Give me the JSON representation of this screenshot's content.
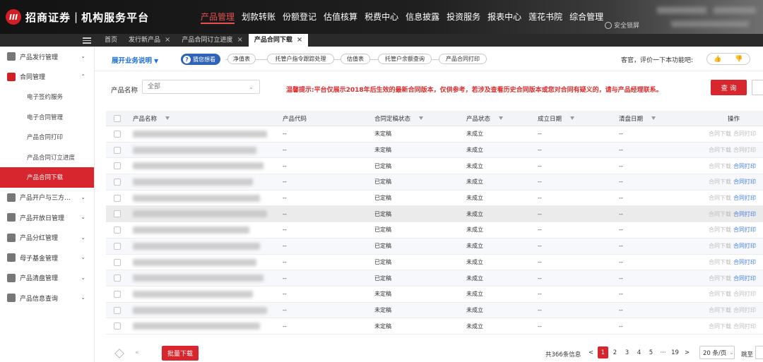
{
  "header": {
    "logo_mark": "III",
    "brand_name": "招商证券",
    "separator": "|",
    "platform_name": "机构服务平台",
    "nav": [
      "产品管理",
      "划款转账",
      "份额登记",
      "估值核算",
      "税费中心",
      "信息披露",
      "投资服务",
      "报表中心",
      "莲花书院",
      "综合管理"
    ],
    "active_nav_index": 0,
    "safe_lock_label": "安全锁屏"
  },
  "tabs": {
    "items": [
      {
        "label": "首页",
        "closable": false
      },
      {
        "label": "发行新产品",
        "closable": true
      },
      {
        "label": "产品合同订立进度",
        "closable": true
      },
      {
        "label": "产品合同下载",
        "closable": true
      }
    ],
    "active_index": 3,
    "close_glyph": "×"
  },
  "sidebar": {
    "groups": [
      {
        "label": "产品发行管理",
        "icon": "document-icon",
        "chevron": "⌄"
      },
      {
        "label": "合同管理",
        "icon": "contract-icon",
        "chevron": "⌃",
        "expanded": true,
        "children": [
          "电子签约服务",
          "电子合同管理",
          "产品合同打印",
          "产品合同订立进度",
          "产品合同下载"
        ],
        "active_child": 4
      },
      {
        "label": "产品开户与三方...",
        "icon": "link-icon",
        "chevron": "⌄"
      },
      {
        "label": "产品开放日管理",
        "icon": "calendar-icon",
        "chevron": "⌄"
      },
      {
        "label": "产品分红管理",
        "icon": "dividend-icon",
        "chevron": "⌄"
      },
      {
        "label": "母子基金管理",
        "icon": "fund-icon",
        "chevron": "⌄"
      },
      {
        "label": "产品清盘管理",
        "icon": "liquidation-icon",
        "chevron": "⌄"
      },
      {
        "label": "产品信息查询",
        "icon": "grid-icon",
        "chevron": "⌄"
      }
    ]
  },
  "func_bar": {
    "dropdown_label": "展开业务说明",
    "dropdown_caret": "▼",
    "guide_label": "猜您想看",
    "guide_glyph": "?",
    "chain": [
      "净值表",
      "托管户指令跟踪处理",
      "估值表",
      "托管户余额查询",
      "产品合同打印"
    ],
    "feedback_text": "客官，评价一下本功能吧:",
    "thumb_up": "👍",
    "thumb_down": "👎"
  },
  "filter": {
    "name_label": "产品名称",
    "name_placeholder": "全部",
    "caret": "⌄",
    "notice": "温馨提示:平台仅展示2018年后生效的最新合同版本，仅供参考，若涉及查看历史合同版本或您对合同有疑义的，请与产品经理联系。",
    "query_label": "查 询"
  },
  "table": {
    "columns": [
      "产品名称",
      "产品代码",
      "合同定稿状态",
      "产品状态",
      "成立日期",
      "清盘日期",
      "操作"
    ],
    "filterable": [
      true,
      false,
      true,
      true,
      true,
      true,
      false
    ],
    "op_download": "合同下载",
    "op_print": "合同打印",
    "rows": [
      {
        "code": "--",
        "status": "未定稿",
        "state": "未成立",
        "setup": "--",
        "clear": "--",
        "print_enabled": false
      },
      {
        "code": "--",
        "status": "未定稿",
        "state": "未成立",
        "setup": "--",
        "clear": "--",
        "print_enabled": false
      },
      {
        "code": "--",
        "status": "已定稿",
        "state": "未成立",
        "setup": "--",
        "clear": "--",
        "print_enabled": true
      },
      {
        "code": "--",
        "status": "已定稿",
        "state": "未成立",
        "setup": "--",
        "clear": "--",
        "print_enabled": true
      },
      {
        "code": "--",
        "status": "已定稿",
        "state": "未成立",
        "setup": "--",
        "clear": "--",
        "print_enabled": true
      },
      {
        "code": "--",
        "status": "已定稿",
        "state": "未成立",
        "setup": "--",
        "clear": "--",
        "print_enabled": true
      },
      {
        "code": "--",
        "status": "已定稿",
        "state": "未成立",
        "setup": "--",
        "clear": "--",
        "print_enabled": true
      },
      {
        "code": "--",
        "status": "已定稿",
        "state": "未成立",
        "setup": "--",
        "clear": "--",
        "print_enabled": true
      },
      {
        "code": "--",
        "status": "已定稿",
        "state": "未成立",
        "setup": "--",
        "clear": "--",
        "print_enabled": true
      },
      {
        "code": "--",
        "status": "已定稿",
        "state": "未成立",
        "setup": "--",
        "clear": "--",
        "print_enabled": true
      },
      {
        "code": "--",
        "status": "未定稿",
        "state": "未成立",
        "setup": "--",
        "clear": "--",
        "print_enabled": false
      },
      {
        "code": "--",
        "status": "未定稿",
        "state": "未成立",
        "setup": "--",
        "clear": "--",
        "print_enabled": false
      },
      {
        "code": "--",
        "status": "未定稿",
        "state": "未成立",
        "setup": "--",
        "clear": "--",
        "print_enabled": false
      }
    ],
    "highlight_row": 5
  },
  "footer": {
    "batch_label": "批量下载",
    "total_text": "共366条信息",
    "prev": "<",
    "pages": [
      "1",
      "2",
      "3",
      "4",
      "5",
      "···",
      "19"
    ],
    "active_page": "1",
    "next": ">",
    "page_size": "20 条/页",
    "page_size_caret": "⌄",
    "goto_label": "跳至",
    "arrow_glyph": "«"
  },
  "colors": {
    "brand_red": "#d7262d",
    "nav_active": "#e94f4f",
    "link_blue": "#3b7be0",
    "notice_red": "#e02b2b"
  }
}
